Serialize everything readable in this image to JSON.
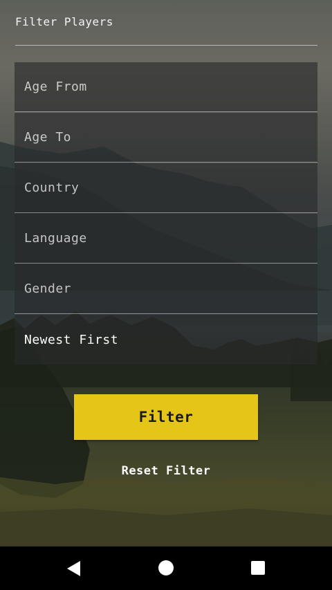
{
  "header": {
    "title": "Filter Players"
  },
  "fields": [
    {
      "placeholder": "Age From"
    },
    {
      "placeholder": "Age To"
    },
    {
      "placeholder": "Country"
    },
    {
      "placeholder": "Language"
    },
    {
      "placeholder": "Gender"
    },
    {
      "value": "Newest First"
    }
  ],
  "actions": {
    "filter_label": "Filter",
    "reset_label": "Reset Filter"
  },
  "colors": {
    "accent": "#e5c618"
  },
  "navbar": {
    "back_icon": "back-triangle-icon",
    "home_icon": "home-circle-icon",
    "recents_icon": "recents-square-icon"
  }
}
